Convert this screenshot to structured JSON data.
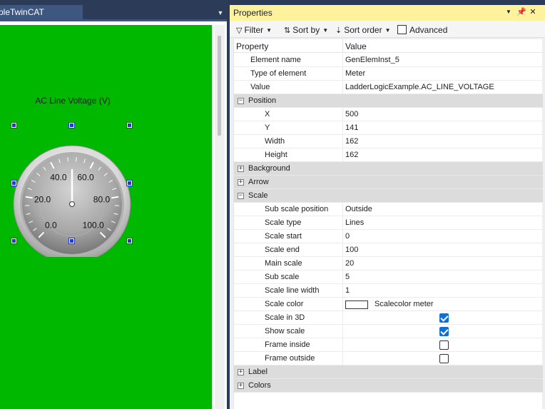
{
  "editor": {
    "tab_label": "pleTwinCAT",
    "meter": {
      "caption": "AC Line Voltage (V)",
      "ticks": [
        "0.0",
        "20.0",
        "40.0",
        "60.0",
        "80.0",
        "100.0"
      ],
      "needle_value": 50,
      "scale_min": 0,
      "scale_max": 100
    },
    "canvas_color": "#00b800"
  },
  "properties": {
    "title": "Properties",
    "toolbar": {
      "filter": "Filter",
      "sort_by": "Sort by",
      "sort_order": "Sort order",
      "advanced": "Advanced"
    },
    "columns": {
      "property": "Property",
      "value": "Value"
    },
    "rows": [
      {
        "type": "prop",
        "indent": 1,
        "name": "Element name",
        "value": "GenElemInst_5"
      },
      {
        "type": "prop",
        "indent": 1,
        "name": "Type of element",
        "value": "Meter"
      },
      {
        "type": "prop",
        "indent": 1,
        "name": "Value",
        "value": "LadderLogicExample.AC_LINE_VOLTAGE"
      },
      {
        "type": "group",
        "name": "Position",
        "expanded": true
      },
      {
        "type": "prop",
        "indent": 2,
        "name": "X",
        "value": "500"
      },
      {
        "type": "prop",
        "indent": 2,
        "name": "Y",
        "value": "141"
      },
      {
        "type": "prop",
        "indent": 2,
        "name": "Width",
        "value": "162"
      },
      {
        "type": "prop",
        "indent": 2,
        "name": "Height",
        "value": "162"
      },
      {
        "type": "group",
        "name": "Background",
        "expanded": false
      },
      {
        "type": "group",
        "name": "Arrow",
        "expanded": false
      },
      {
        "type": "group",
        "name": "Scale",
        "expanded": true
      },
      {
        "type": "prop",
        "indent": 2,
        "name": "Sub scale position",
        "value": "Outside"
      },
      {
        "type": "prop",
        "indent": 2,
        "name": "Scale type",
        "value": "Lines"
      },
      {
        "type": "prop",
        "indent": 2,
        "name": "Scale start",
        "value": "0"
      },
      {
        "type": "prop",
        "indent": 2,
        "name": "Scale end",
        "value": "100"
      },
      {
        "type": "prop",
        "indent": 2,
        "name": "Main scale",
        "value": "20"
      },
      {
        "type": "prop",
        "indent": 2,
        "name": "Sub scale",
        "value": "5"
      },
      {
        "type": "prop",
        "indent": 2,
        "name": "Scale line width",
        "value": "1"
      },
      {
        "type": "color",
        "indent": 2,
        "name": "Scale color",
        "value": "Scalecolor meter",
        "color": "#ffffff"
      },
      {
        "type": "check",
        "indent": 2,
        "name": "Scale in 3D",
        "checked": true
      },
      {
        "type": "check",
        "indent": 2,
        "name": "Show scale",
        "checked": true
      },
      {
        "type": "check",
        "indent": 2,
        "name": "Frame inside",
        "checked": false
      },
      {
        "type": "check",
        "indent": 2,
        "name": "Frame outside",
        "checked": false
      },
      {
        "type": "group",
        "name": "Label",
        "expanded": false
      },
      {
        "type": "group",
        "name": "Colors",
        "expanded": false
      }
    ]
  }
}
